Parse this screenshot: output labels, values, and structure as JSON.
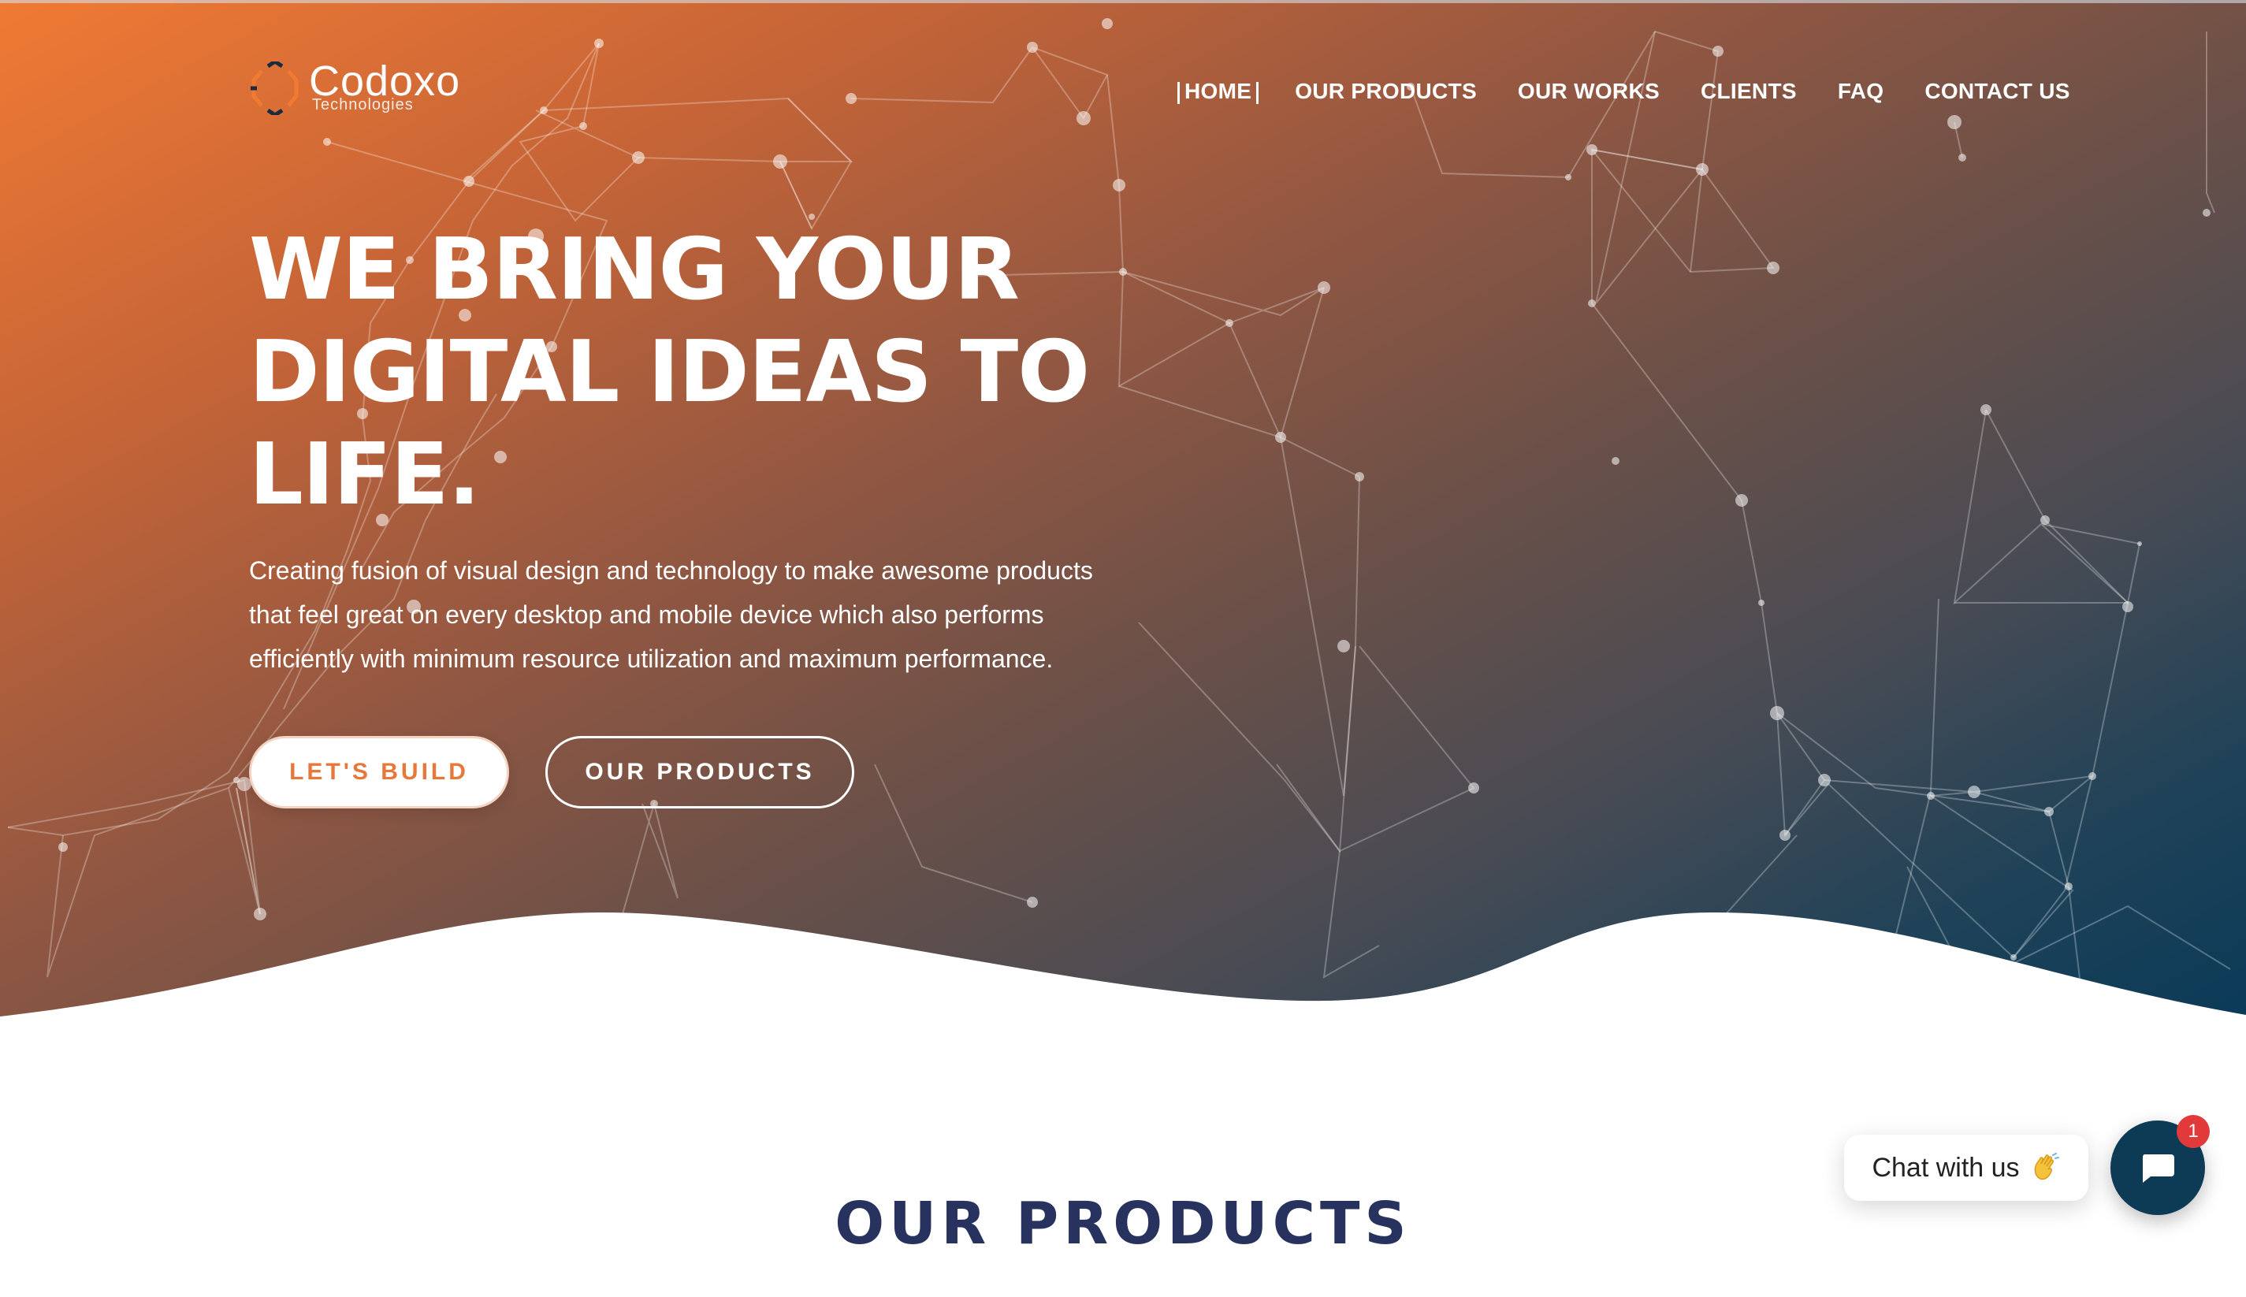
{
  "brand": {
    "name": "Codoxo",
    "tagline": "Technologies",
    "accent_color": "#e8773a",
    "navy_color": "#27325f",
    "dark_teal": "#0d3a55"
  },
  "nav": {
    "items": [
      {
        "label": "HOME",
        "active": true
      },
      {
        "label": "OUR PRODUCTS",
        "active": false
      },
      {
        "label": "OUR WORKS",
        "active": false
      },
      {
        "label": "CLIENTS",
        "active": false
      },
      {
        "label": "FAQ",
        "active": false
      },
      {
        "label": "CONTACT US",
        "active": false
      }
    ]
  },
  "hero": {
    "headline_line1": "WE BRING YOUR",
    "headline_line2": "DIGITAL IDEAS TO",
    "headline_line3": "LIFE.",
    "description_line1": "Creating fusion of visual design and technology to make awesome products",
    "description_line2": "that feel great on every desktop and mobile device which also performs",
    "description_line3": "efficiently with minimum resource utilization and maximum performance.",
    "primary_button": "LET'S BUILD",
    "secondary_button": "OUR PRODUCTS",
    "background_icon": "network-constellation"
  },
  "products_section": {
    "title": "OUR PRODUCTS"
  },
  "chat": {
    "label": "Chat with us",
    "emoji_icon": "waving-hand-icon",
    "button_icon": "chat-bubble-icon",
    "badge_count": "1"
  }
}
